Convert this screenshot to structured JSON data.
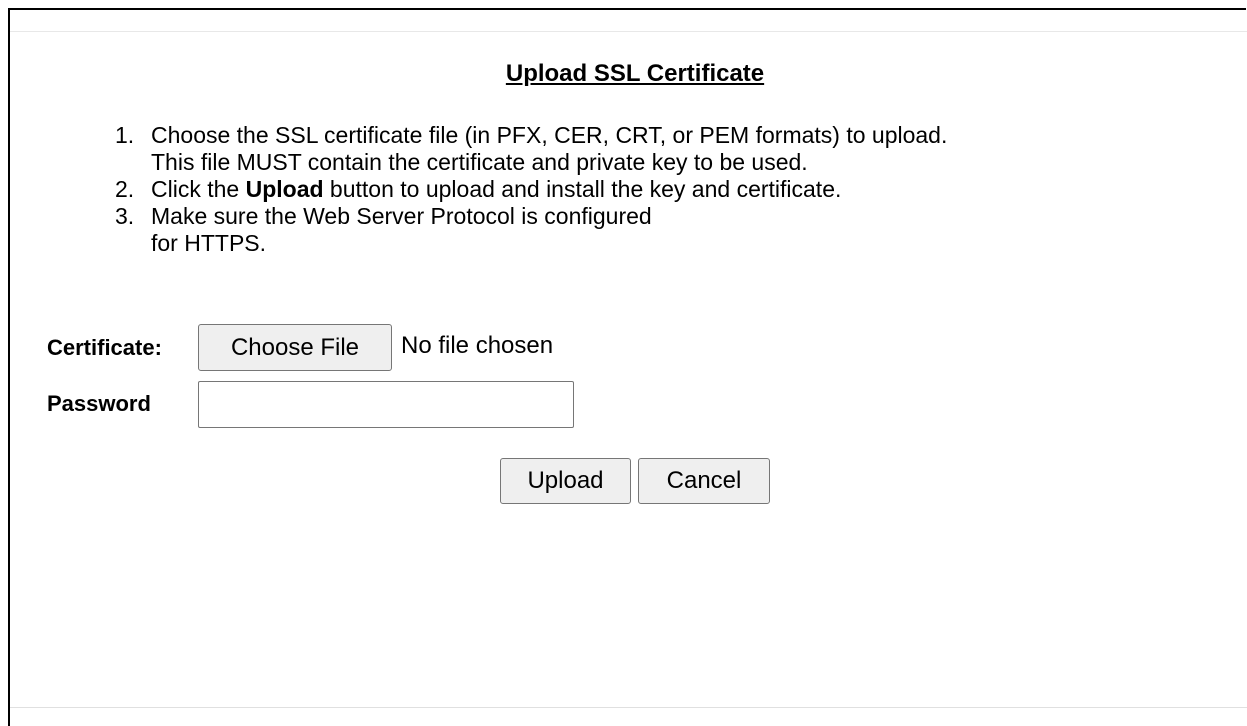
{
  "title": "Upload SSL Certificate",
  "instructions": [
    {
      "num": "1.",
      "pre": "Choose the SSL certificate file (in PFX, CER, CRT, or PEM formats) to upload.\nThis file MUST contain the certificate and private key to be used.",
      "bold": "",
      "post": ""
    },
    {
      "num": "2.",
      "pre": "Click the ",
      "bold": "Upload",
      "post": " button to upload and install the key and certificate."
    },
    {
      "num": "3.",
      "pre": "Make sure the Web Server Protocol is configured\nfor HTTPS.",
      "bold": "",
      "post": ""
    }
  ],
  "certificate": {
    "label": "Certificate:",
    "choose_button": "Choose File",
    "status": "No file chosen"
  },
  "password": {
    "label": "Password",
    "value": ""
  },
  "actions": {
    "upload_label": "Upload",
    "cancel_label": "Cancel"
  }
}
